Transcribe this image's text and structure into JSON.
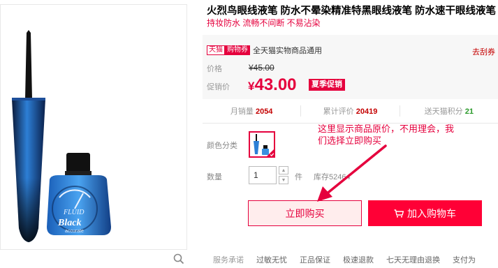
{
  "product": {
    "title": "火烈鸟眼线液笔 防水不晕染精准特黑眼线液笔 防水速干眼线液笔",
    "subtitle": "持妆防水 流畅不间断 不易沾染"
  },
  "promo": {
    "tmall_tag": "天猫",
    "coupon_tag": "购物券",
    "coupon_text": "全天猫实物商品通用",
    "get_coupon": "去刮券"
  },
  "price": {
    "label": "价格",
    "original": "¥45.00",
    "promo_label": "促销价",
    "currency": "¥",
    "promo_value": "43.00",
    "season_tag": "夏季促销"
  },
  "stats": {
    "monthly_label": "月销量",
    "monthly_value": "2054",
    "reviews_label": "累计评价",
    "reviews_value": "20419",
    "points_label": "送天猫积分",
    "points_value": "21"
  },
  "options": {
    "color_label": "颜色分类",
    "qty_label": "数量",
    "qty_value": "1",
    "unit": "件",
    "stock": "库存52464"
  },
  "actions": {
    "buy_now": "立即购买",
    "add_cart": "加入购物车"
  },
  "service": {
    "label": "服务承诺",
    "items": [
      "过敏无忧",
      "正品保证",
      "极速退款",
      "七天无理由退换",
      "支付为"
    ]
  },
  "annotation": {
    "line1": "这里显示商品原价，不用理会，我",
    "line2": "们选择立即购买"
  },
  "colors": {
    "accent": "#e5003d",
    "cart_button": "#ff0036",
    "price_bg": "#f7f7f7"
  }
}
